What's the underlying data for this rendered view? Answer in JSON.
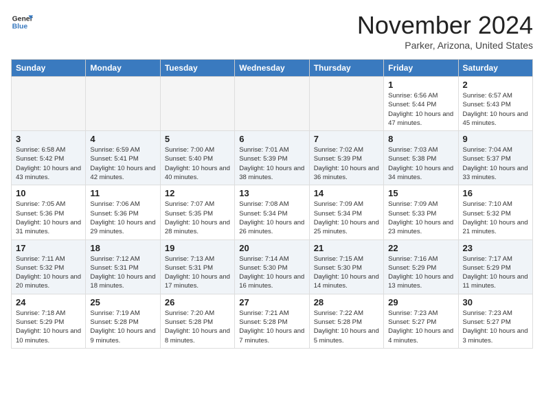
{
  "header": {
    "logo_general": "General",
    "logo_blue": "Blue",
    "month_title": "November 2024",
    "location": "Parker, Arizona, United States"
  },
  "days_of_week": [
    "Sunday",
    "Monday",
    "Tuesday",
    "Wednesday",
    "Thursday",
    "Friday",
    "Saturday"
  ],
  "weeks": [
    [
      {
        "day": "",
        "info": ""
      },
      {
        "day": "",
        "info": ""
      },
      {
        "day": "",
        "info": ""
      },
      {
        "day": "",
        "info": ""
      },
      {
        "day": "",
        "info": ""
      },
      {
        "day": "1",
        "info": "Sunrise: 6:56 AM\nSunset: 5:44 PM\nDaylight: 10 hours and 47 minutes."
      },
      {
        "day": "2",
        "info": "Sunrise: 6:57 AM\nSunset: 5:43 PM\nDaylight: 10 hours and 45 minutes."
      }
    ],
    [
      {
        "day": "3",
        "info": "Sunrise: 6:58 AM\nSunset: 5:42 PM\nDaylight: 10 hours and 43 minutes."
      },
      {
        "day": "4",
        "info": "Sunrise: 6:59 AM\nSunset: 5:41 PM\nDaylight: 10 hours and 42 minutes."
      },
      {
        "day": "5",
        "info": "Sunrise: 7:00 AM\nSunset: 5:40 PM\nDaylight: 10 hours and 40 minutes."
      },
      {
        "day": "6",
        "info": "Sunrise: 7:01 AM\nSunset: 5:39 PM\nDaylight: 10 hours and 38 minutes."
      },
      {
        "day": "7",
        "info": "Sunrise: 7:02 AM\nSunset: 5:39 PM\nDaylight: 10 hours and 36 minutes."
      },
      {
        "day": "8",
        "info": "Sunrise: 7:03 AM\nSunset: 5:38 PM\nDaylight: 10 hours and 34 minutes."
      },
      {
        "day": "9",
        "info": "Sunrise: 7:04 AM\nSunset: 5:37 PM\nDaylight: 10 hours and 33 minutes."
      }
    ],
    [
      {
        "day": "10",
        "info": "Sunrise: 7:05 AM\nSunset: 5:36 PM\nDaylight: 10 hours and 31 minutes."
      },
      {
        "day": "11",
        "info": "Sunrise: 7:06 AM\nSunset: 5:36 PM\nDaylight: 10 hours and 29 minutes."
      },
      {
        "day": "12",
        "info": "Sunrise: 7:07 AM\nSunset: 5:35 PM\nDaylight: 10 hours and 28 minutes."
      },
      {
        "day": "13",
        "info": "Sunrise: 7:08 AM\nSunset: 5:34 PM\nDaylight: 10 hours and 26 minutes."
      },
      {
        "day": "14",
        "info": "Sunrise: 7:09 AM\nSunset: 5:34 PM\nDaylight: 10 hours and 25 minutes."
      },
      {
        "day": "15",
        "info": "Sunrise: 7:09 AM\nSunset: 5:33 PM\nDaylight: 10 hours and 23 minutes."
      },
      {
        "day": "16",
        "info": "Sunrise: 7:10 AM\nSunset: 5:32 PM\nDaylight: 10 hours and 21 minutes."
      }
    ],
    [
      {
        "day": "17",
        "info": "Sunrise: 7:11 AM\nSunset: 5:32 PM\nDaylight: 10 hours and 20 minutes."
      },
      {
        "day": "18",
        "info": "Sunrise: 7:12 AM\nSunset: 5:31 PM\nDaylight: 10 hours and 18 minutes."
      },
      {
        "day": "19",
        "info": "Sunrise: 7:13 AM\nSunset: 5:31 PM\nDaylight: 10 hours and 17 minutes."
      },
      {
        "day": "20",
        "info": "Sunrise: 7:14 AM\nSunset: 5:30 PM\nDaylight: 10 hours and 16 minutes."
      },
      {
        "day": "21",
        "info": "Sunrise: 7:15 AM\nSunset: 5:30 PM\nDaylight: 10 hours and 14 minutes."
      },
      {
        "day": "22",
        "info": "Sunrise: 7:16 AM\nSunset: 5:29 PM\nDaylight: 10 hours and 13 minutes."
      },
      {
        "day": "23",
        "info": "Sunrise: 7:17 AM\nSunset: 5:29 PM\nDaylight: 10 hours and 11 minutes."
      }
    ],
    [
      {
        "day": "24",
        "info": "Sunrise: 7:18 AM\nSunset: 5:29 PM\nDaylight: 10 hours and 10 minutes."
      },
      {
        "day": "25",
        "info": "Sunrise: 7:19 AM\nSunset: 5:28 PM\nDaylight: 10 hours and 9 minutes."
      },
      {
        "day": "26",
        "info": "Sunrise: 7:20 AM\nSunset: 5:28 PM\nDaylight: 10 hours and 8 minutes."
      },
      {
        "day": "27",
        "info": "Sunrise: 7:21 AM\nSunset: 5:28 PM\nDaylight: 10 hours and 7 minutes."
      },
      {
        "day": "28",
        "info": "Sunrise: 7:22 AM\nSunset: 5:28 PM\nDaylight: 10 hours and 5 minutes."
      },
      {
        "day": "29",
        "info": "Sunrise: 7:23 AM\nSunset: 5:27 PM\nDaylight: 10 hours and 4 minutes."
      },
      {
        "day": "30",
        "info": "Sunrise: 7:23 AM\nSunset: 5:27 PM\nDaylight: 10 hours and 3 minutes."
      }
    ]
  ]
}
